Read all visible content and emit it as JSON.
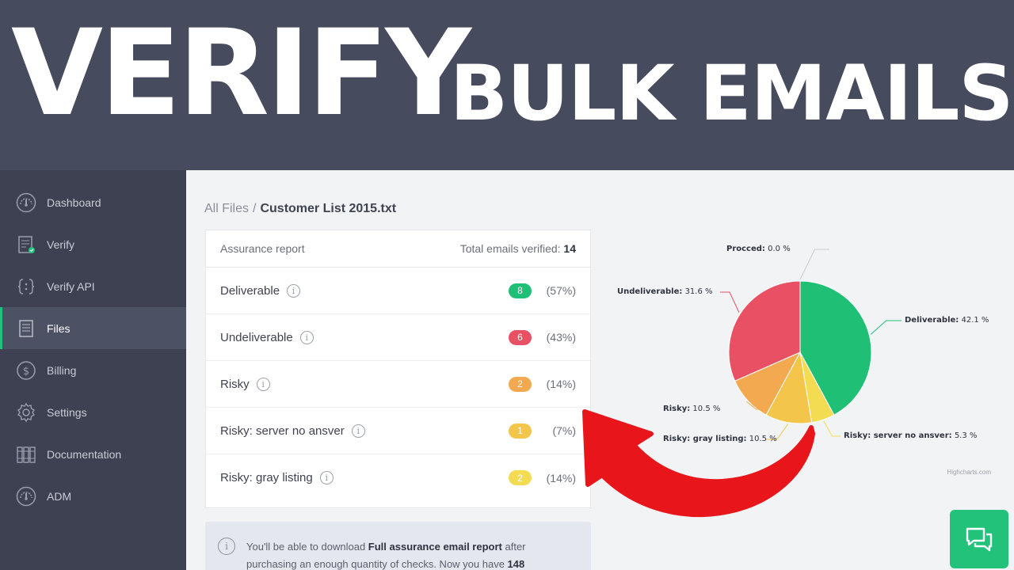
{
  "banner": {
    "title": "VERIFY",
    "subtitle": "BULK EMAILS"
  },
  "sidebar": {
    "items": [
      {
        "label": "Dashboard",
        "icon": "gauge-icon"
      },
      {
        "label": "Verify",
        "icon": "document-check-icon"
      },
      {
        "label": "Verify API",
        "icon": "code-braces-icon"
      },
      {
        "label": "Files",
        "icon": "file-icon",
        "active": true
      },
      {
        "label": "Billing",
        "icon": "dollar-icon"
      },
      {
        "label": "Settings",
        "icon": "gear-icon"
      },
      {
        "label": "Documentation",
        "icon": "books-icon"
      },
      {
        "label": "ADM",
        "icon": "gauge-icon"
      }
    ]
  },
  "breadcrumb": {
    "root": "All Files",
    "separator": "/",
    "current": "Customer List 2015.txt"
  },
  "report": {
    "title": "Assurance report",
    "total_label": "Total emails verified:",
    "total_value": "14",
    "rows": [
      {
        "label": "Deliverable",
        "count": "8",
        "pct": "(57%)",
        "color": "#1fbf75"
      },
      {
        "label": "Undeliverable",
        "count": "6",
        "pct": "(43%)",
        "color": "#e95063"
      },
      {
        "label": "Risky",
        "count": "2",
        "pct": "(14%)",
        "color": "#f2a94f"
      },
      {
        "label": "Risky: server no ansver",
        "count": "1",
        "pct": "(7%)",
        "color": "#f3c64b"
      },
      {
        "label": "Risky: gray listing",
        "count": "2",
        "pct": "(14%)",
        "color": "#f4dc52"
      }
    ]
  },
  "notice": {
    "line1_pre": "You'll be able to download ",
    "line1_bold": "Full assurance email report",
    "line1_post": " after",
    "line2_pre": "purchasing an enough quantity of checks. Now you have ",
    "line2_bold": "148"
  },
  "chart_data": {
    "type": "pie",
    "slices": [
      {
        "name": "Deliverable",
        "value": 42.1,
        "label": "42.1 %",
        "color": "#1fbf75"
      },
      {
        "name": "Risky: server no ansver",
        "value": 5.3,
        "label": "5.3 %",
        "color": "#f4dc52"
      },
      {
        "name": "Risky: gray listing",
        "value": 10.5,
        "label": "10.5 %",
        "color": "#f3c64b"
      },
      {
        "name": "Risky",
        "value": 10.5,
        "label": "10.5 %",
        "color": "#f2a94f"
      },
      {
        "name": "Undeliverable",
        "value": 31.6,
        "label": "31.6 %",
        "color": "#e95063"
      },
      {
        "name": "Procced",
        "value": 0.0,
        "label": "0.0 %",
        "color": "#cfcfcf"
      }
    ],
    "credits": "Highcharts.com"
  },
  "colors": {
    "accent": "#22c27a",
    "arrow": "#e8151b"
  },
  "chat": {
    "icon": "chat-bubbles-icon"
  }
}
